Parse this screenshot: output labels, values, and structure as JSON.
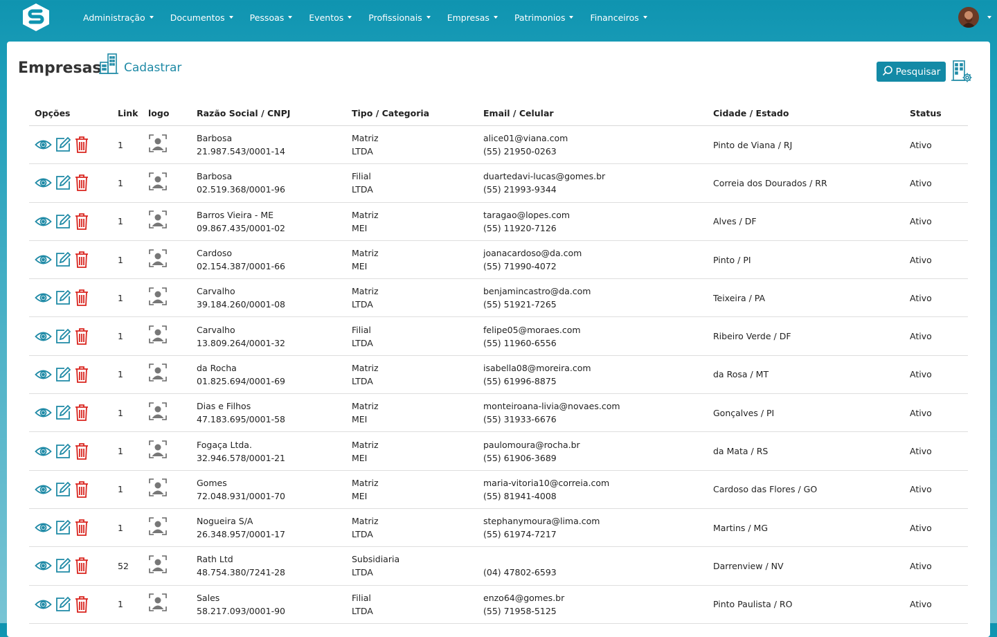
{
  "nav": {
    "items": [
      "Administração",
      "Documentos",
      "Pessoas",
      "Eventos",
      "Profissionais",
      "Empresas",
      "Patrimonios",
      "Financeiros"
    ]
  },
  "page": {
    "title": "Empresas",
    "cadastrar": "Cadastrar",
    "search_label": "Pesquisar"
  },
  "table": {
    "headers": [
      "Opções",
      "Link",
      "logo",
      "Razão Social / CNPJ",
      "Tipo / Categoria",
      "Email / Celular",
      "Cidade / Estado",
      "Status"
    ],
    "rows": [
      {
        "link": "1",
        "name": "Barbosa",
        "cnpj": "21.987.543/0001-14",
        "tipo": "Matriz",
        "cat": "LTDA",
        "email": "alice01@viana.com",
        "phone": "(55) 21950-0263",
        "city": "Pinto de Viana / RJ",
        "status": "Ativo"
      },
      {
        "link": "1",
        "name": "Barbosa",
        "cnpj": "02.519.368/0001-96",
        "tipo": "Filial",
        "cat": "LTDA",
        "email": "duartedavi-lucas@gomes.br",
        "phone": "(55) 21993-9344",
        "city": "Correia dos Dourados / RR",
        "status": "Ativo"
      },
      {
        "link": "1",
        "name": "Barros Vieira - ME",
        "cnpj": "09.867.435/0001-02",
        "tipo": "Matriz",
        "cat": "MEI",
        "email": "taragao@lopes.com",
        "phone": "(55) 11920-7126",
        "city": "Alves / DF",
        "status": "Ativo"
      },
      {
        "link": "1",
        "name": "Cardoso",
        "cnpj": "02.154.387/0001-66",
        "tipo": "Matriz",
        "cat": "MEI",
        "email": "joanacardoso@da.com",
        "phone": "(55) 71990-4072",
        "city": "Pinto / PI",
        "status": "Ativo"
      },
      {
        "link": "1",
        "name": "Carvalho",
        "cnpj": "39.184.260/0001-08",
        "tipo": "Matriz",
        "cat": "LTDA",
        "email": "benjamincastro@da.com",
        "phone": "(55) 51921-7265",
        "city": "Teixeira / PA",
        "status": "Ativo"
      },
      {
        "link": "1",
        "name": "Carvalho",
        "cnpj": "13.809.264/0001-32",
        "tipo": "Filial",
        "cat": "LTDA",
        "email": "felipe05@moraes.com",
        "phone": "(55) 11960-6556",
        "city": "Ribeiro Verde / DF",
        "status": "Ativo"
      },
      {
        "link": "1",
        "name": "da Rocha",
        "cnpj": "01.825.694/0001-69",
        "tipo": "Matriz",
        "cat": "LTDA",
        "email": "isabella08@moreira.com",
        "phone": "(55) 61996-8875",
        "city": "da Rosa / MT",
        "status": "Ativo"
      },
      {
        "link": "1",
        "name": "Dias e Filhos",
        "cnpj": "47.183.695/0001-58",
        "tipo": "Matriz",
        "cat": "MEI",
        "email": "monteiroana-livia@novaes.com",
        "phone": "(55) 31933-6676",
        "city": "Gonçalves / PI",
        "status": "Ativo"
      },
      {
        "link": "1",
        "name": "Fogaça Ltda.",
        "cnpj": "32.946.578/0001-21",
        "tipo": "Matriz",
        "cat": "MEI",
        "email": "paulomoura@rocha.br",
        "phone": "(55) 61906-3689",
        "city": "da Mata / RS",
        "status": "Ativo"
      },
      {
        "link": "1",
        "name": "Gomes",
        "cnpj": "72.048.931/0001-70",
        "tipo": "Matriz",
        "cat": "MEI",
        "email": "maria-vitoria10@correia.com",
        "phone": "(55) 81941-4008",
        "city": "Cardoso das Flores / GO",
        "status": "Ativo"
      },
      {
        "link": "1",
        "name": "Nogueira S/A",
        "cnpj": "26.348.957/0001-17",
        "tipo": "Matriz",
        "cat": "LTDA",
        "email": "stephanymoura@lima.com",
        "phone": "(55) 61974-7217",
        "city": "Martins / MG",
        "status": "Ativo"
      },
      {
        "link": "52",
        "name": "Rath Ltd",
        "cnpj": "48.754.380/7241-28",
        "tipo": "Subsidiaria",
        "cat": "LTDA",
        "email": "",
        "phone": "(04) 47802-6593",
        "city": "Darrenview / NV",
        "status": "Ativo"
      },
      {
        "link": "1",
        "name": "Sales",
        "cnpj": "58.217.093/0001-90",
        "tipo": "Filial",
        "cat": "LTDA",
        "email": "enzo64@gomes.br",
        "phone": "(55) 71958-5125",
        "city": "Pinto Paulista / RO",
        "status": "Ativo"
      }
    ]
  }
}
